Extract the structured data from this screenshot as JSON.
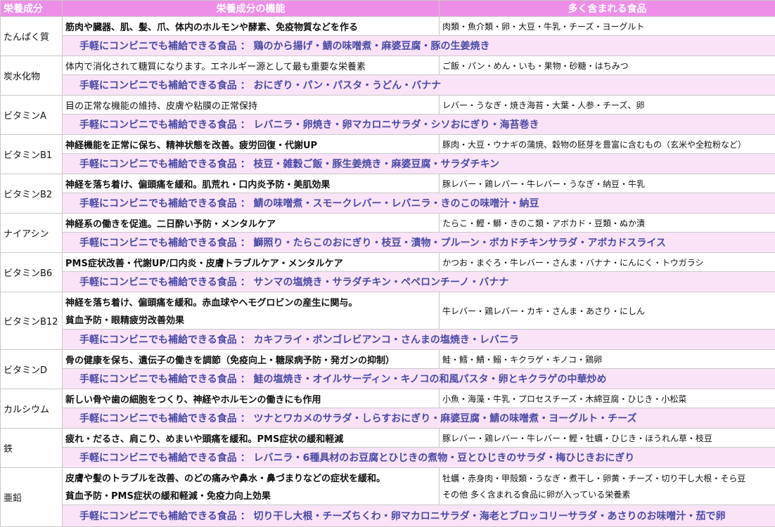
{
  "headers": [
    "栄養成分",
    "栄養成分の機能",
    "多く含まれる食品"
  ],
  "convenience_prefix": "手軽にコンビニでも補給できる食品 ：",
  "rows": [
    {
      "name": "たんぱく質",
      "function": "筋肉や臓器、肌、髪、爪、体内のホルモンや酵素、免疫物質などを作る",
      "foods": "肉類・魚介類・卵・大豆・牛乳・チーズ・ヨーグルト",
      "convenience": "鶏のから揚げ・鯖の味噌煮・麻婆豆腐・豚の生姜焼き"
    },
    {
      "name": "炭水化物",
      "function": "体内で消化されて糖質になります。エネルギー源として最も重要な栄養素",
      "foods": "ご飯・パン・めん・いも・果物・砂糖・はちみつ",
      "convenience": "おにぎり・パン・パスタ・うどん・バナナ"
    },
    {
      "name": "ビタミンA",
      "function": "目の正常な機能の維持、皮膚や粘膜の正常保持",
      "foods": "レバー・うなぎ・焼き海苔・大葉・人参・チーズ、卵",
      "convenience": "レバニラ・卵焼き・卵マカロニサラダ・シソおにぎり・海苔巻き"
    },
    {
      "name": "ビタミンB1",
      "function": "神経機能を正常に保ち、精神状態を改善。疲労回復・代謝UP",
      "foods": "豚肉・大豆・ウナギの蒲焼、穀物の胚芽を豊富に含むもの（玄米や全粒粉など）",
      "convenience": "枝豆・雑穀ご飯・豚生姜焼き・麻婆豆腐・サラダチキン"
    },
    {
      "name": "ビタミンB2",
      "function": "神経を落ち着け、偏頭痛を緩和。肌荒れ・口内炎予防・美肌効果",
      "foods": "豚レバー・鶏レバー・牛レバー・うなぎ・納豆・牛乳",
      "convenience": "鯖の味噌煮・スモークレバー・レバニラ・きのこの味噌汁・納豆"
    },
    {
      "name": "ナイアシン",
      "function": "神経系の働きを促進。二日酔い予防・メンタルケア",
      "foods": "たらこ・鰹・鰤・きのこ類・アボカド・豆類・ぬか漬",
      "convenience": "鰤照り・たらこのおにぎり・枝豆・漬物・プルーン・ボカドチキンサラダ・アボカドスライス"
    },
    {
      "name": "ビタミンB6",
      "function": "PMS症状改善・代謝UP/口内炎・皮膚トラブルケア・メンタルケア",
      "foods": "かつお・まぐろ・牛レバー・さんま・バナナ・にんにく・トウガラシ",
      "convenience": "サンマの塩焼き・サラダチキン・ペペロンチーノ・バナナ"
    },
    {
      "name": "ビタミンB12",
      "function": "神経を落ち着け、偏頭痛を緩和。赤血球やヘモグロビンの産生に関与。",
      "function2": "貧血予防・眼精疲労改善効果",
      "foods": "牛レバー・鶏レバー・カキ・さんま・あさり・にしん",
      "convenience": "カキフライ・ボンゴレビアンコ・さんまの塩焼き・レバニラ"
    },
    {
      "name": "ビタミンD",
      "function": "骨の健康を保ち、遺伝子の働きを調節（免疫向上・糖尿病予防・発ガンの抑制）",
      "foods": "鮭・鱈・鯖・鰯・キクラゲ・キノコ・鶏卵",
      "convenience": "鮭の塩焼き・オイルサーディン・キノコの和風パスタ・卵とキクラゲの中華炒め"
    },
    {
      "name": "カルシウム",
      "function": "新しい骨や歯の細胞をつくり、神経やホルモンの働きにも作用",
      "foods": "小魚・海藻・牛乳・プロセスチーズ・木綿豆腐・ひじき・小松菜",
      "convenience": "ツナとワカメのサラダ・しらすおにぎり・麻婆豆腐・鯖の味噌煮・ヨーグルト・チーズ"
    },
    {
      "name": "鉄",
      "function": "疲れ・だるさ、肩こり、めまいや頭痛を緩和。PMS症状の緩和軽減",
      "foods": "豚レバー・鶏レバー・牛レバー・鰹・牡蠣・ひじき・ほうれん草・枝豆",
      "convenience": "レバニラ・6種具材のお豆腐とひじきの煮物・豆とひじきのサラダ・梅ひじきおにぎり"
    },
    {
      "name": "亜鉛",
      "function": "皮膚や髪のトラブルを改善、のどの痛みや鼻水・鼻づまりなどの症状を緩和。",
      "function2": "貧血予防・PMS症状の緩和軽減・免疫力向上効果",
      "foods": "牡蠣・赤身肉・甲殻類・うなぎ・煮干し・卵黄・チーズ・切り干し大根・そら豆",
      "foods2": "その他 多く含まれる食品に卵が入っている栄養素",
      "convenience": "切り干し大根・チーズちくわ・卵マカロニサラダ・海老とブロッコリーサラダ・あさりのお味噌汁・茄で卵"
    }
  ],
  "colors": {
    "header_bg": "#ee8ee8",
    "conv_bg": "#fae3f7",
    "conv_text": "#4a4aa6"
  }
}
